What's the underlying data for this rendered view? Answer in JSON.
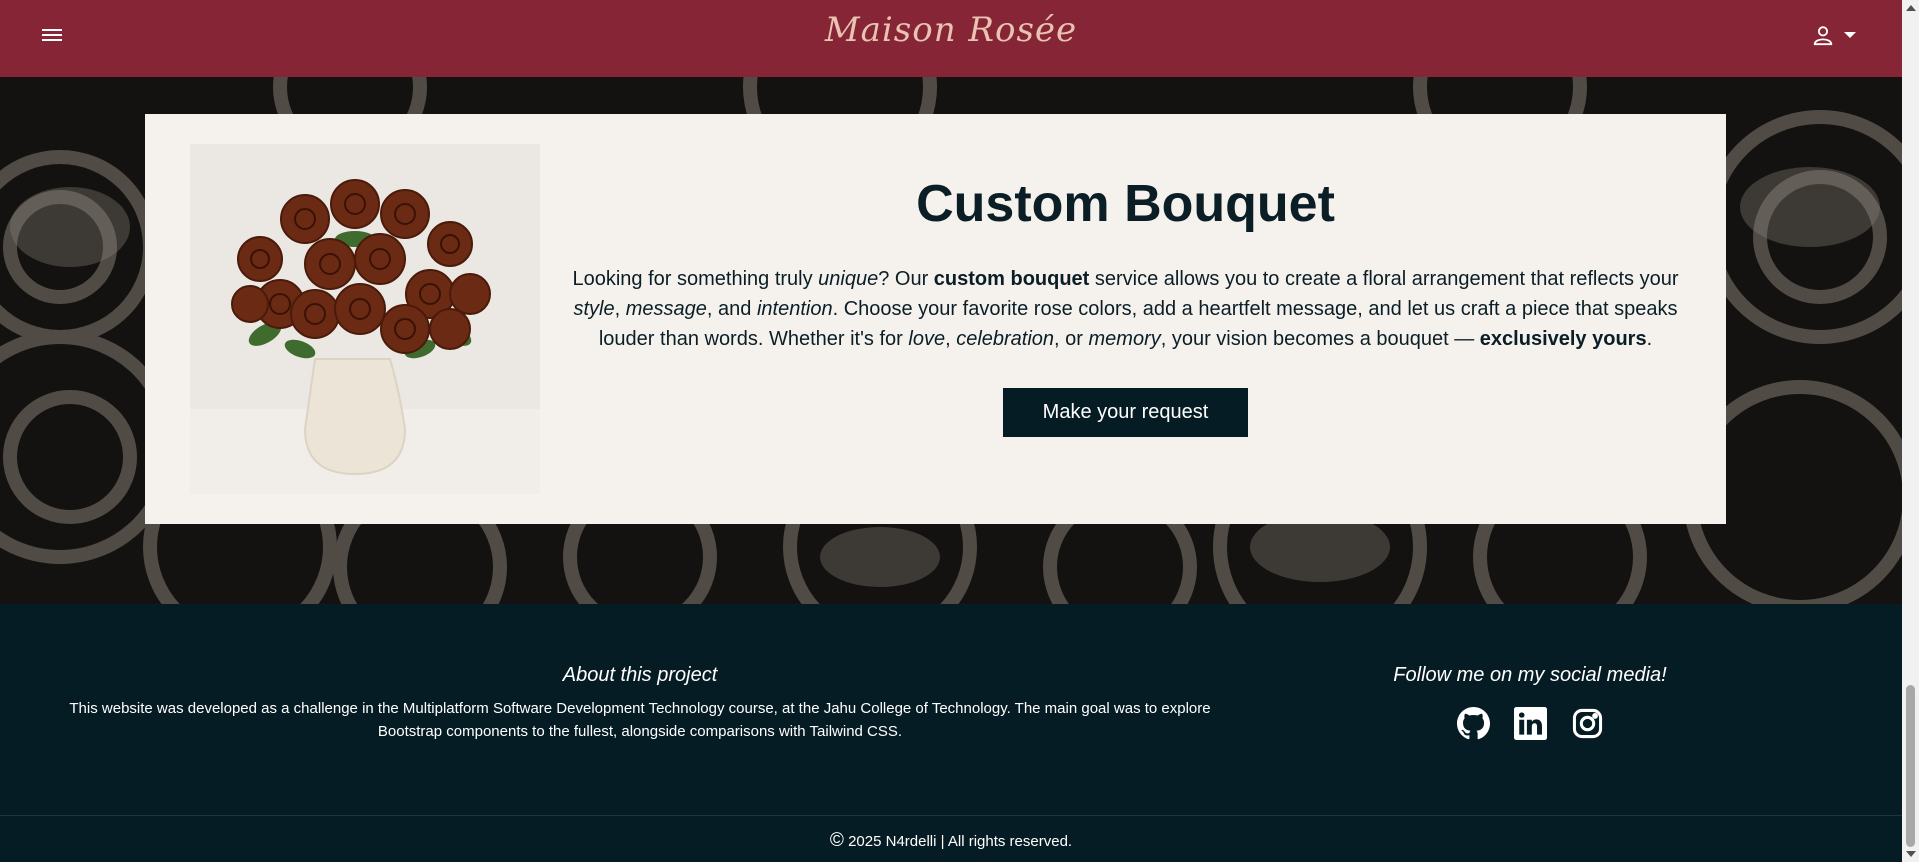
{
  "navbar": {
    "brand": "Maison Rosée",
    "menu_icon": "hamburger-menu-icon",
    "user_icon": "user-icon",
    "caret_icon": "caret-down-icon"
  },
  "hero": {
    "card": {
      "title": "Custom Bouquet",
      "text": {
        "p1": "Looking for something truly ",
        "unique": "unique",
        "p2": "? Our ",
        "custom_bouquet": "custom bouquet",
        "p3": " service allows you to create a floral arrangement that reflects your ",
        "style": "style",
        "c1": ", ",
        "message": "message",
        "c2": ", and ",
        "intention": "intention",
        "p4": ". Choose your favorite rose colors, add a heartfelt message, and let us craft a piece that speaks louder than words. Whether it's for ",
        "love": "love",
        "c3": ", ",
        "celebration": "celebration",
        "c4": ", or ",
        "memory": "memory",
        "p5": ", your vision becomes a bouquet — ",
        "exclusively_yours": "exclusively yours",
        "p6": "."
      },
      "button": "Make your request"
    }
  },
  "footer": {
    "about_title": "About this project",
    "about_text": "This website was developed as a challenge in the Multiplatform Software Development Technology course, at the Jahu College of Technology. The main goal was to explore Bootstrap components to the fullest, alongside comparisons with Tailwind CSS.",
    "social_title": "Follow me on my social media!",
    "social_icons": [
      "github-icon",
      "linkedin-icon",
      "instagram-icon"
    ],
    "copyright_symbol": "©",
    "copyright": "2025 N4rdelli | All rights reserved."
  },
  "colors": {
    "navbar": "#862536",
    "brand": "#e9c2b2",
    "footer": "#061c24",
    "card": "#f5f2ee",
    "button": "#061c24"
  }
}
